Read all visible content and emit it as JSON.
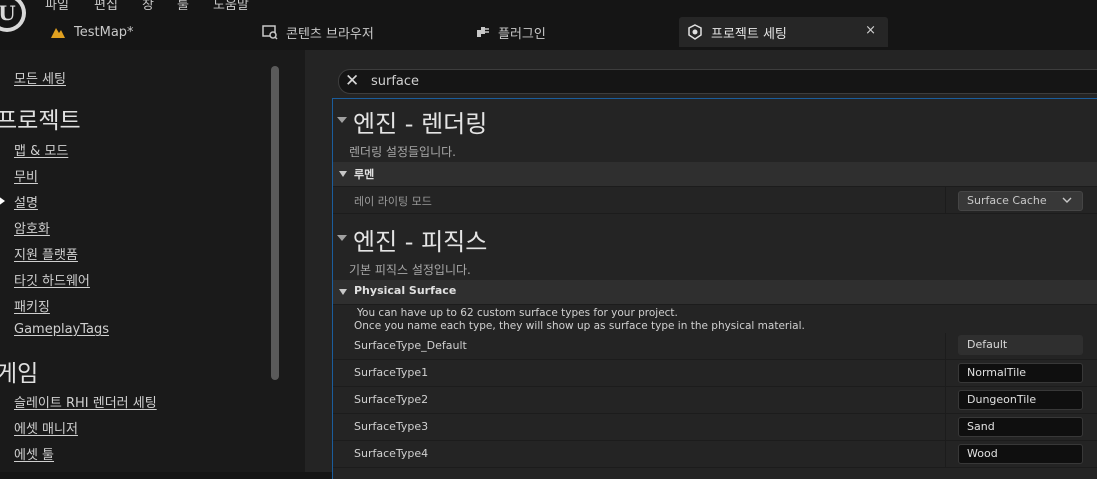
{
  "menu": [
    "파일",
    "편집",
    "창",
    "툴",
    "도움말"
  ],
  "tabs": [
    {
      "label": "TestMap*",
      "icon": "level-icon"
    },
    {
      "label": "콘텐츠 브라우저",
      "icon": "content-browser-icon"
    },
    {
      "label": "플러그인",
      "icon": "plugin-icon"
    },
    {
      "label": "프로젝트 세팅",
      "icon": "project-settings-icon",
      "active": true
    }
  ],
  "tab_close": "×",
  "sidebar": {
    "all_settings": "모든 세팅",
    "project_heading": "프로젝트",
    "project_items": [
      "맵 & 모드",
      "무비",
      "설명",
      "암호화",
      "지원 플랫폼",
      "타깃 하드웨어",
      "패키징",
      "GameplayTags"
    ],
    "selected_item": "설명",
    "game_heading": "게임",
    "game_items": [
      "슬레이트 RHI 렌더러 세팅",
      "에셋 매니저",
      "에셋 툴"
    ]
  },
  "search": {
    "value": "surface",
    "clear_icon": "close-icon"
  },
  "sections": [
    {
      "title": "엔진 - 렌더링",
      "description": "렌더링 설정들입니다.",
      "category": "루멘",
      "rows": [
        {
          "label": "레이 라이팅 모드",
          "value": "Surface Cache",
          "type": "combo"
        }
      ]
    },
    {
      "title": "엔진 - 피직스",
      "description": "기본 피직스 설정입니다.",
      "category": "Physical Surface",
      "note_line1": "You can have up to 62 custom surface types for your project.",
      "note_line2": "Once you name each type, they will show up as surface type in the physical material.",
      "rows": [
        {
          "label": "SurfaceType_Default",
          "value": "Default",
          "type": "readonly"
        },
        {
          "label": "SurfaceType1",
          "value": "NormalTile",
          "type": "text"
        },
        {
          "label": "SurfaceType2",
          "value": "DungeonTile",
          "type": "text"
        },
        {
          "label": "SurfaceType3",
          "value": "Sand",
          "type": "text"
        },
        {
          "label": "SurfaceType4",
          "value": "Wood",
          "type": "text"
        }
      ]
    }
  ],
  "colors": {
    "accent": "#1b5d9c",
    "background": "#242424",
    "panel": "#1a1a1a"
  }
}
